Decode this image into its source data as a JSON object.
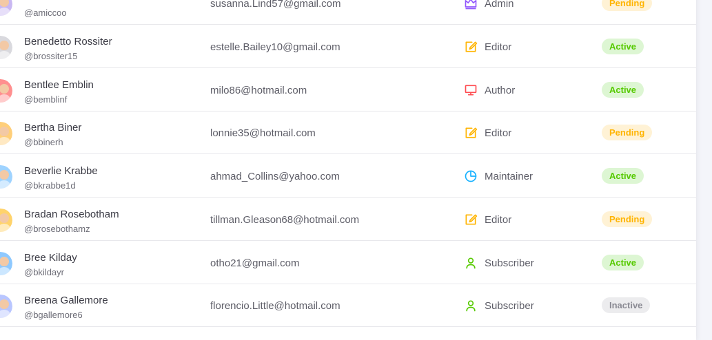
{
  "users": [
    {
      "name": "",
      "username": "@amiccoo",
      "email": "susanna.Lind57@gmail.com",
      "role": "Admin",
      "role_icon": "crown-icon",
      "status": "Pending",
      "status_kind": "pending",
      "avatar_color": "#c9b8f2"
    },
    {
      "name": "Benedetto Rossiter",
      "username": "@brossiter15",
      "email": "estelle.Bailey10@gmail.com",
      "role": "Editor",
      "role_icon": "edit-icon",
      "status": "Active",
      "status_kind": "active",
      "avatar_color": "#d9d9de"
    },
    {
      "name": "Bentlee Emblin",
      "username": "@bemblinf",
      "email": "milo86@hotmail.com",
      "role": "Author",
      "role_icon": "monitor-icon",
      "status": "Active",
      "status_kind": "active",
      "avatar_color": "#ff8f8f"
    },
    {
      "name": "Bertha Biner",
      "username": "@bbinerh",
      "email": "lonnie35@hotmail.com",
      "role": "Editor",
      "role_icon": "edit-icon",
      "status": "Pending",
      "status_kind": "pending",
      "avatar_color": "#ffcf7a"
    },
    {
      "name": "Beverlie Krabbe",
      "username": "@bkrabbe1d",
      "email": "ahmad_Collins@yahoo.com",
      "role": "Maintainer",
      "role_icon": "pie-chart-icon",
      "status": "Active",
      "status_kind": "active",
      "avatar_color": "#9fd3ff"
    },
    {
      "name": "Bradan Rosebotham",
      "username": "@brosebothamz",
      "email": "tillman.Gleason68@hotmail.com",
      "role": "Editor",
      "role_icon": "edit-icon",
      "status": "Pending",
      "status_kind": "pending",
      "avatar_color": "#ffd36b"
    },
    {
      "name": "Bree Kilday",
      "username": "@bkildayr",
      "email": "otho21@gmail.com",
      "role": "Subscriber",
      "role_icon": "user-icon",
      "status": "Active",
      "status_kind": "active",
      "avatar_color": "#8ec9ff"
    },
    {
      "name": "Breena Gallemore",
      "username": "@bgallemore6",
      "email": "florencio.Little@hotmail.com",
      "role": "Subscriber",
      "role_icon": "user-icon",
      "status": "Inactive",
      "status_kind": "inactive",
      "avatar_color": "#b9c6ff"
    }
  ],
  "role_colors": {
    "Admin": "#9155fd",
    "Editor": "#ffb400",
    "Author": "#ff4c51",
    "Maintainer": "#16b1ff",
    "Subscriber": "#56ca00"
  }
}
